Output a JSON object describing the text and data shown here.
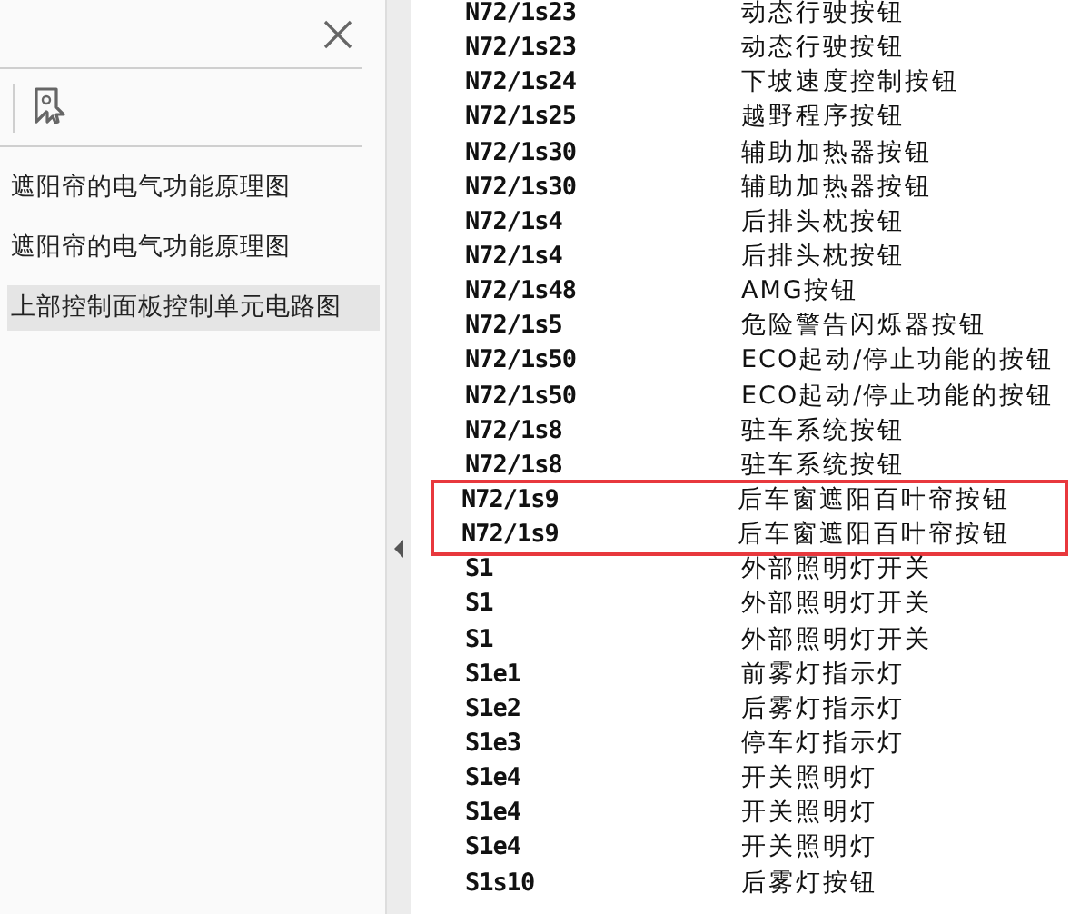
{
  "sidebar": {
    "bookmarks": [
      {
        "label": "遮阳帘的电气功能原理图",
        "selected": false
      },
      {
        "label": "遮阳帘的电气功能原理图",
        "selected": false
      },
      {
        "label": "上部控制面板控制单元电路图",
        "selected": true
      }
    ]
  },
  "document": {
    "rows": [
      {
        "code": "N72/1s23",
        "description": "动态行驶按钮",
        "highlighted": false
      },
      {
        "code": "N72/1s23",
        "description": "动态行驶按钮",
        "highlighted": false
      },
      {
        "code": "N72/1s24",
        "description": "下坡速度控制按钮",
        "highlighted": false
      },
      {
        "code": "N72/1s25",
        "description": "越野程序按钮",
        "highlighted": false
      },
      {
        "code": "N72/1s30",
        "description": "辅助加热器按钮",
        "highlighted": false
      },
      {
        "code": "N72/1s30",
        "description": "辅助加热器按钮",
        "highlighted": false
      },
      {
        "code": "N72/1s4",
        "description": "后排头枕按钮",
        "highlighted": false
      },
      {
        "code": "N72/1s4",
        "description": "后排头枕按钮",
        "highlighted": false
      },
      {
        "code": "N72/1s48",
        "description": "AMG按钮",
        "highlighted": false
      },
      {
        "code": "N72/1s5",
        "description": "危险警告闪烁器按钮",
        "highlighted": false
      },
      {
        "code": "N72/1s50",
        "description": "ECO起动/停止功能的按钮",
        "highlighted": false
      },
      {
        "code": "N72/1s50",
        "description": "ECO起动/停止功能的按钮",
        "highlighted": false
      },
      {
        "code": "N72/1s8",
        "description": "驻车系统按钮",
        "highlighted": false
      },
      {
        "code": "N72/1s8",
        "description": "驻车系统按钮",
        "highlighted": false
      },
      {
        "code": "N72/1s9",
        "description": "后车窗遮阳百叶帘按钮",
        "highlighted": true
      },
      {
        "code": "N72/1s9",
        "description": "后车窗遮阳百叶帘按钮",
        "highlighted": true
      },
      {
        "code": "S1",
        "description": "外部照明灯开关",
        "highlighted": false
      },
      {
        "code": "S1",
        "description": "外部照明灯开关",
        "highlighted": false
      },
      {
        "code": "S1",
        "description": "外部照明灯开关",
        "highlighted": false
      },
      {
        "code": "S1e1",
        "description": "前雾灯指示灯",
        "highlighted": false
      },
      {
        "code": "S1e2",
        "description": "后雾灯指示灯",
        "highlighted": false
      },
      {
        "code": "S1e3",
        "description": "停车灯指示灯",
        "highlighted": false
      },
      {
        "code": "S1e4",
        "description": "开关照明灯",
        "highlighted": false
      },
      {
        "code": "S1e4",
        "description": "开关照明灯",
        "highlighted": false
      },
      {
        "code": "S1e4",
        "description": "开关照明灯",
        "highlighted": false
      },
      {
        "code": "S1s10",
        "description": "后雾灯按钮",
        "highlighted": false
      }
    ]
  }
}
